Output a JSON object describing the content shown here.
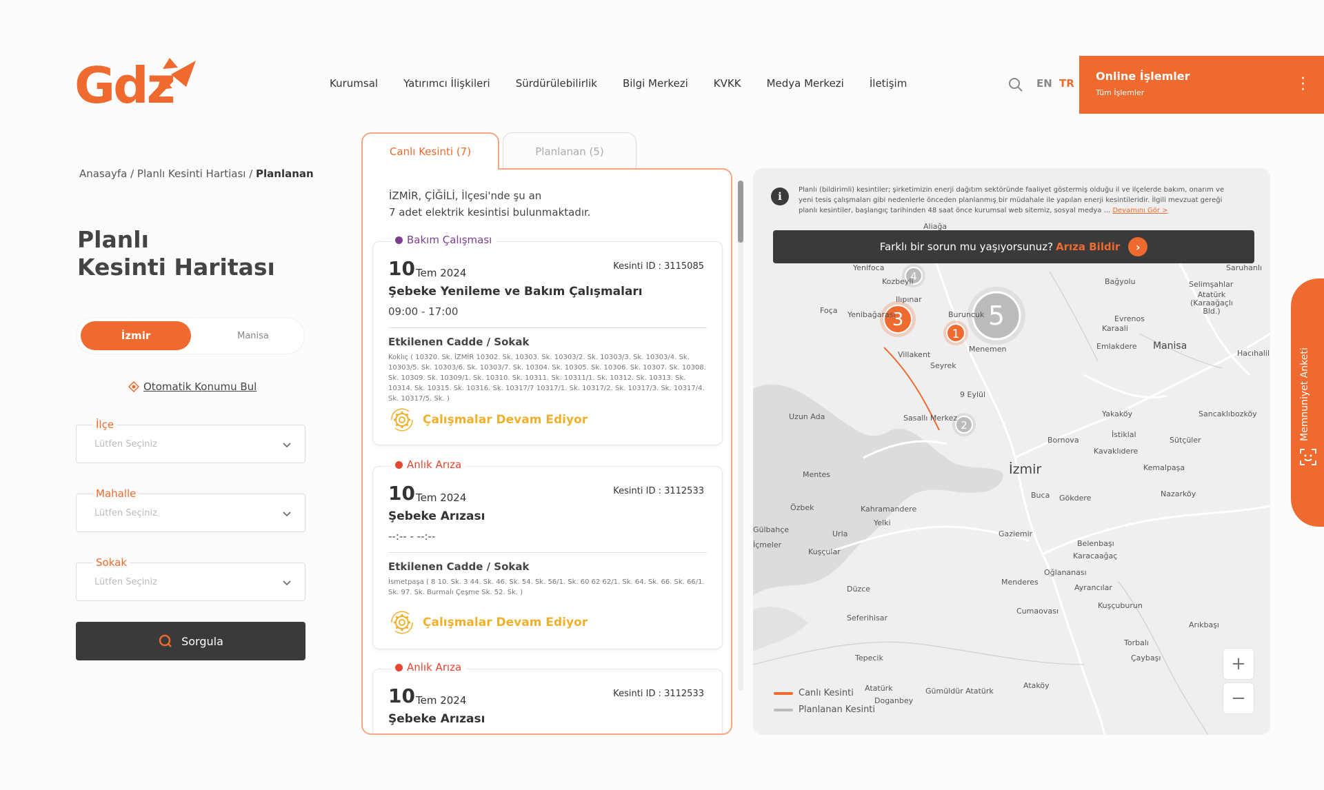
{
  "header": {
    "logo_text": "Gdz",
    "nav": [
      "Kurumsal",
      "Yatırımcı İlişkileri",
      "Sürdürülebilirlik",
      "Bilgi Merkezi",
      "KVKK",
      "Medya Merkezi",
      "İletişim"
    ],
    "lang_en": "EN",
    "lang_tr": "TR",
    "online_title": "Online İşlemler",
    "online_sub": "Tüm İşlemler",
    "brand_color": "#ee6a2e"
  },
  "breadcrumb": {
    "home": "Anasayfa",
    "sep": " / ",
    "mid": "Planlı Kesinti Hartiası",
    "current": "Planlanan"
  },
  "title": {
    "line1": "Planlı",
    "line2": "Kesinti Haritası"
  },
  "city_toggle": {
    "active": "İzmir",
    "inactive": "Manisa"
  },
  "auto_location": "Otomatik Konumu Bul",
  "fields": [
    {
      "label": "İlçe",
      "placeholder": "Lütfen Seçiniz"
    },
    {
      "label": "Mahalle",
      "placeholder": "Lütfen Seçiniz"
    },
    {
      "label": "Sokak",
      "placeholder": "Lütfen Seçiniz"
    }
  ],
  "query_button": "Sorgula",
  "tabs": {
    "live": "Canlı Kesinti (7)",
    "planned": "Planlanan (5)"
  },
  "list": {
    "intro_line1": "İZMİR, ÇİĞİLİ, İlçesi'nde şu an",
    "intro_line2": "7 adet elektrik kesintisi bulunmaktadır.",
    "cards": [
      {
        "type": "Bakım Çalışması",
        "type_color": "#7b3f8e",
        "day": "10",
        "month_year": "Tem 2024",
        "id": "Kesinti ID : 3115085",
        "title": "Şebeke Yenileme ve Bakım Çalışmaları",
        "time": "09:00 - 17:00",
        "streets_heading": "Etkilenen Cadde / Sokak",
        "streets": "Koklıç ( 10320. Sk. İZMİR 10302. Sk. 10303. Sk. 10303/2. Sk. 10303/3. Sk. 10303/4. Sk. 10303/5. Sk. 10303/6. Sk. 10303/7. Sk. 10304. Sk. 10305. Sk. 10306. Sk. 10307. Sk. 10308. Sk. 10309. Sk. 10309/1. Sk. 10310. Sk. 10311. Sk. 10311/1. Sk. 10312. Sk. 10313. Sk. 10314. Sk. 10315. Sk. 10316. Sk. 10317/7 10317/1. Sk. 10317/2. Sk. 10317/3. Sk. 10317/4. Sk. 10317/5. Sk. )",
        "status": "Çalışmalar Devam Ediyor"
      },
      {
        "type": "Anlık Arıza",
        "type_color": "#e8442e",
        "day": "10",
        "month_year": "Tem 2024",
        "id": "Kesinti ID : 3112533",
        "title": "Şebeke Arızası",
        "time": "--:-- - --:--",
        "streets_heading": "Etkilenen Cadde / Sokak",
        "streets": "İsmetpaşa ( 8 10. Sk. 3 44. Sk. 46. Sk. 54. Sk. 56/1. Sk. 60 62 62/1. Sk. 64. Sk. 66. Sk. 66/1. Sk. 97. Sk. Burmalı Çeşme Sk. 52. Sk. )",
        "status": "Çalışmalar Devam Ediyor"
      },
      {
        "type": "Anlık Arıza",
        "type_color": "#e8442e",
        "day": "10",
        "month_year": "Tem 2024",
        "id": "Kesinti ID : 3112533",
        "title": "Şebeke Arızası"
      }
    ]
  },
  "map": {
    "info_text": "Planlı (bildirimli) kesintiler; şirketimizin enerji dağıtım sektöründe faaliyet göstermiş olduğu il ve ilçelerde bakım, onarım ve yeni tesis çalışmaları gibi nedenlerle önceden planlanmış bir müdahale ile yapılan enerji kesintileridir. İlgili mevzuat gereği planlı kesintiler, başlangıç tarihinden 48 saat önce kurumsal web sitemiz, sosyal medya ...",
    "info_link": "Devamını Gör >",
    "report_text": "Farklı bir sorun mu yaşıyorsunuz?",
    "report_link": "Arıza Bildir",
    "clusters": [
      {
        "label": "3",
        "kind": "live"
      },
      {
        "label": "1",
        "kind": "live"
      },
      {
        "label": "4",
        "kind": "planned"
      },
      {
        "label": "5",
        "kind": "planned"
      },
      {
        "label": "2",
        "kind": "planned"
      }
    ],
    "places": [
      "Aliağa",
      "Yenifoca",
      "Kozbeyli",
      "Ilıpınar",
      "Foça",
      "Yenibağarası",
      "Buruncuk",
      "Villakent",
      "Menemen",
      "Seyrek",
      "9 Eylül",
      "Sasallı Merkez",
      "Uzun Ada",
      "Bornova",
      "İzmir",
      "Mentes",
      "Özbek",
      "Kahramandere",
      "Yelki",
      "Buca",
      "Gökdere",
      "Gaziemir",
      "Gülbahçe",
      "Urla",
      "İçmeler",
      "Kuşçular",
      "Menderes",
      "Düzce",
      "Oğlananası",
      "Ayrancılar",
      "Kuşçuburun",
      "Cumaovası",
      "Seferihisar",
      "Tepecik",
      "Torbalı",
      "Çaybaşı",
      "Atatürk",
      "Doganbey",
      "Gümüldür Atatürk",
      "Ataköy",
      "Bağyolu",
      "Selimşahlar",
      "Atatürk (Karaağaçlı Bld.)",
      "Evrenos",
      "Karaali",
      "Emlakdere",
      "Manisa",
      "Hacıhalil",
      "Yakaköy",
      "İstiklal",
      "Sancaklıbozköy",
      "Sütçüler",
      "Kavaklıdere",
      "Kemalpaşa",
      "Nazarköy",
      "Belenbaşı",
      "Karacaağaç",
      "Arıkbaşı",
      "Saruhanlı"
    ],
    "legend_live": "Canlı Kesinti",
    "legend_planned": "Planlanan Kesinti",
    "legend_live_color": "#ee6a2e",
    "legend_planned_color": "#bbbbbb",
    "zoom_in": "+",
    "zoom_out": "−"
  },
  "survey_label": "Memnuniyet Anketi"
}
